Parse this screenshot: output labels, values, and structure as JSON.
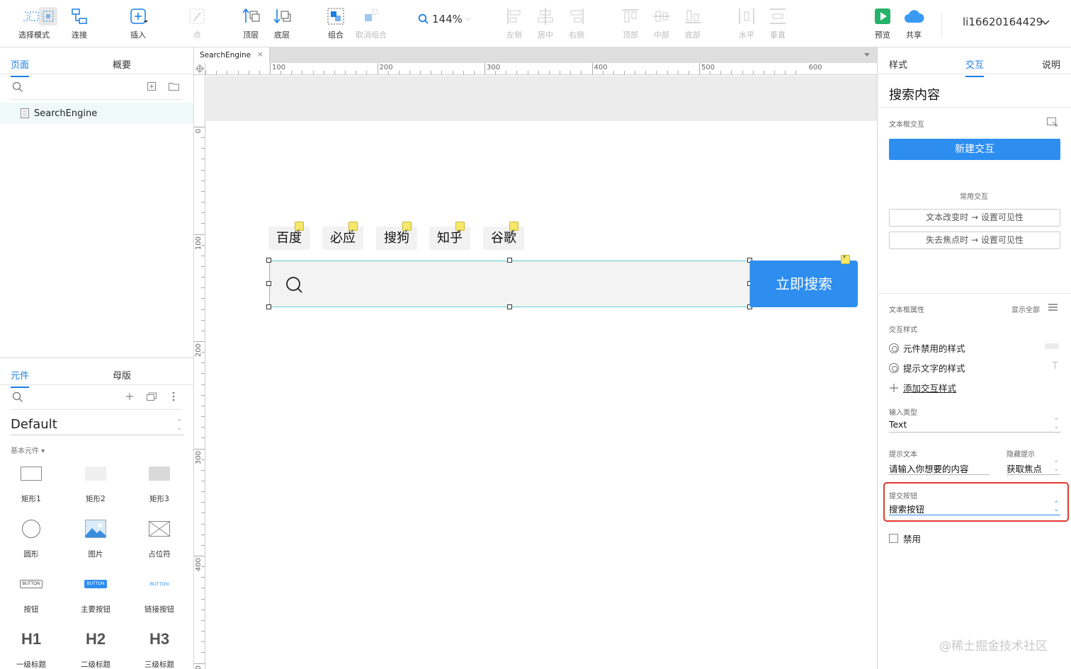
{
  "toolbar": {
    "items": [
      {
        "label": "选择模式"
      },
      {
        "label": "连接"
      },
      {
        "label": "插入"
      },
      {
        "label": "点"
      },
      {
        "label": "顶层"
      },
      {
        "label": "底层"
      },
      {
        "label": "组合"
      },
      {
        "label": "取消组合"
      },
      {
        "label": "左侧"
      },
      {
        "label": "居中"
      },
      {
        "label": "右侧"
      },
      {
        "label": "顶部"
      },
      {
        "label": "中部"
      },
      {
        "label": "底部"
      },
      {
        "label": "水平"
      },
      {
        "label": "垂直"
      },
      {
        "label": "预览"
      },
      {
        "label": "共享"
      }
    ],
    "zoom": "144%",
    "user": "li16620164429"
  },
  "left_panel": {
    "tabs": {
      "pages": "页面",
      "outline": "概要"
    },
    "page_name": "SearchEngine",
    "lib_tabs": {
      "widgets": "元件",
      "masters": "母版"
    },
    "library": "Default",
    "category": "基本元件 ▾",
    "widgets": [
      {
        "label": "矩形1"
      },
      {
        "label": "矩形2"
      },
      {
        "label": "矩形3"
      },
      {
        "label": "圆形"
      },
      {
        "label": "图片"
      },
      {
        "label": "占位符"
      },
      {
        "label": "按钮"
      },
      {
        "label": "主要按钮"
      },
      {
        "label": "链接按钮"
      },
      {
        "label": "一级标题"
      },
      {
        "label": "二级标题"
      },
      {
        "label": "三级标题"
      }
    ],
    "button_icon_text": "BUTTON",
    "headings": {
      "h1": "H1",
      "h2": "H2",
      "h3": "H3"
    }
  },
  "canvas": {
    "doc_tab": "SearchEngine",
    "doc_tab_close": "×",
    "ruler_h": [
      "100",
      "200",
      "300",
      "400",
      "500",
      "600"
    ],
    "ruler_v": [
      "0",
      "100",
      "200",
      "300",
      "400",
      "00"
    ],
    "engines": [
      "百度",
      "必应",
      "搜狗",
      "知乎",
      "谷歌"
    ],
    "search_button": "立即搜索"
  },
  "right_panel": {
    "tabs": {
      "style": "样式",
      "interact": "交互",
      "notes": "说明"
    },
    "widget_name": "搜索内容",
    "textbox_interactions": "文本框交互",
    "new_interaction": "新建交互",
    "common_interactions": "常用交互",
    "common_items": [
      "文本改变时 → 设置可见性",
      "失去焦点时 → 设置可见性"
    ],
    "textbox_props": "文本框属性",
    "show_all": "显示全部",
    "interaction_styles": "交互样式",
    "disabled_style": "元件禁用的样式",
    "hint_style": "提示文字的样式",
    "add_style": "添加交互样式",
    "input_type_label": "输入类型",
    "input_type": "Text",
    "hint_text_label": "提示文本",
    "hint_text": "请输入你想要的内容",
    "hide_hint_label": "隐藏提示",
    "hide_hint": "获取焦点",
    "submit_label": "提交按钮",
    "submit_value": "搜索按钮",
    "disable_label": "禁用",
    "highlight_color": "#e0392f",
    "accent": "#2d8ef0"
  },
  "watermark": "@稀土掘金技术社区"
}
